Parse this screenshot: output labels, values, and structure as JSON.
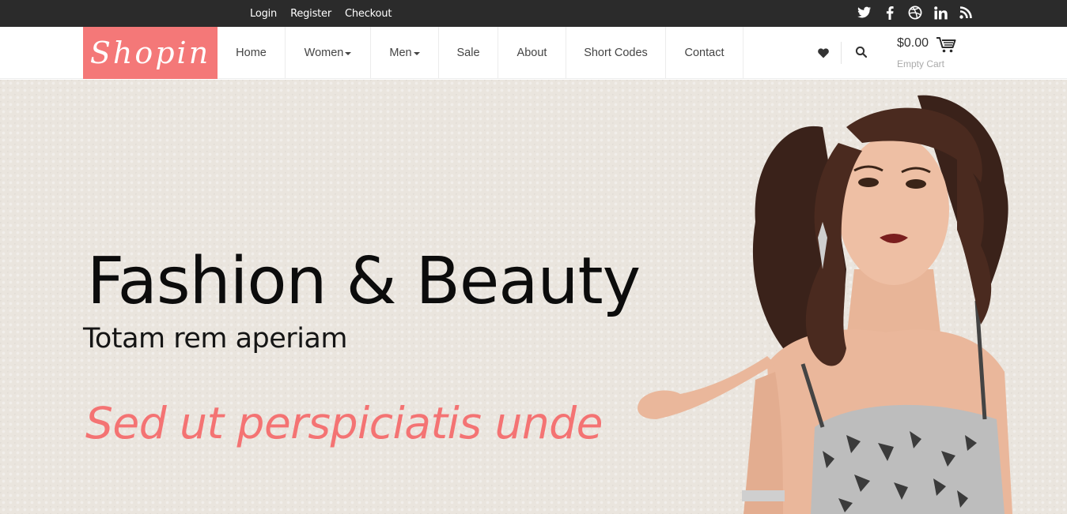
{
  "topbar": {
    "links": [
      "Login",
      "Register",
      "Checkout"
    ],
    "social": [
      "twitter-icon",
      "facebook-icon",
      "dribbble-icon",
      "linkedin-icon",
      "rss-icon"
    ]
  },
  "brand": {
    "logo_text": "Shopin",
    "accent_color": "#f47878"
  },
  "nav": {
    "items": [
      {
        "label": "Home",
        "dropdown": false
      },
      {
        "label": "Women",
        "dropdown": true
      },
      {
        "label": "Men",
        "dropdown": true
      },
      {
        "label": "Sale",
        "dropdown": false
      },
      {
        "label": "About",
        "dropdown": false
      },
      {
        "label": "Short Codes",
        "dropdown": false
      },
      {
        "label": "Contact",
        "dropdown": false
      }
    ]
  },
  "cart": {
    "amount": "$0.00",
    "status": "Empty Cart"
  },
  "hero": {
    "title": "Fashion & Beauty",
    "subtitle": "Totam rem aperiam",
    "tagline": "Sed ut perspiciatis unde",
    "tagline_color": "#f47373"
  }
}
